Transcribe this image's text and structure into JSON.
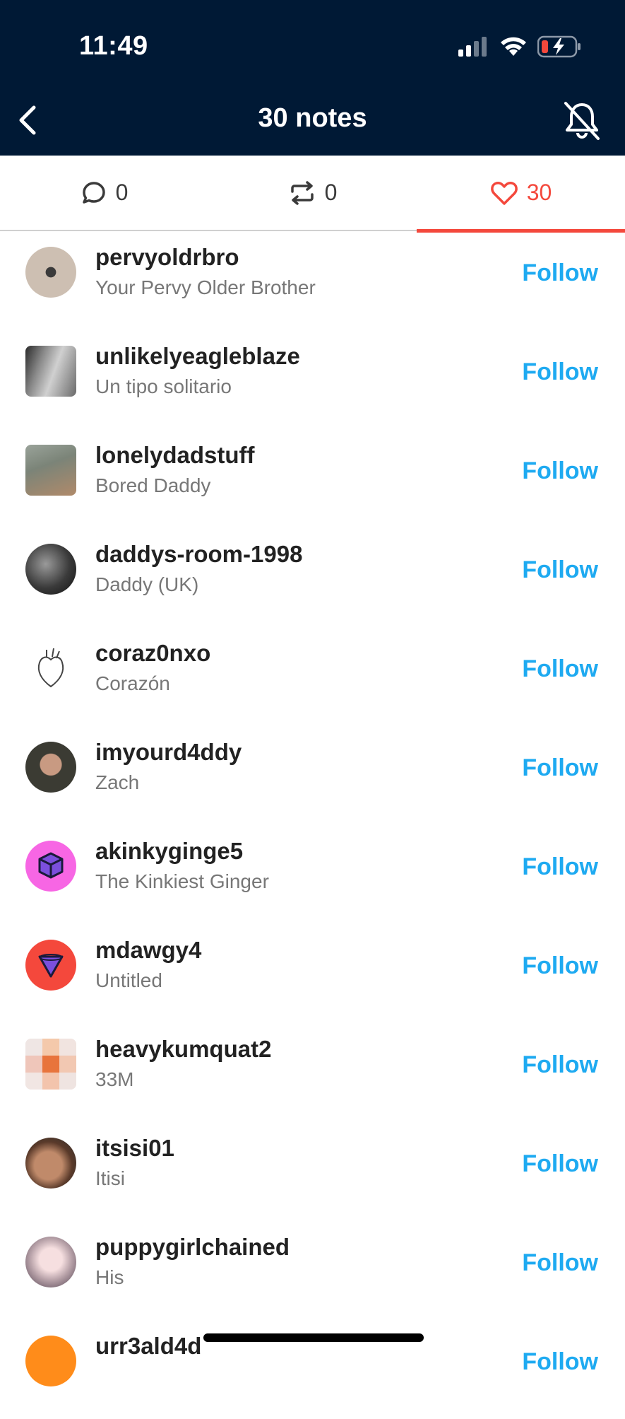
{
  "status": {
    "time": "11:49"
  },
  "header": {
    "title": "30 notes"
  },
  "tabs": [
    {
      "icon": "comment-icon",
      "count": "0"
    },
    {
      "icon": "reblog-icon",
      "count": "0"
    },
    {
      "icon": "heart-icon",
      "count": "30"
    }
  ],
  "colors": {
    "header_bg": "#001935",
    "accent_red": "#f4483c",
    "follow_blue": "#1eaaf1"
  },
  "follow_label": "Follow",
  "users": [
    {
      "username": "pervyoldrbro",
      "title": "Your Pervy Older Brother"
    },
    {
      "username": "unlikelyeagleblaze",
      "title": "Un tipo solitario"
    },
    {
      "username": "lonelydadstuff",
      "title": "Bored Daddy"
    },
    {
      "username": "daddys-room-1998",
      "title": "Daddy (UK)"
    },
    {
      "username": "coraz0nxo",
      "title": "Corazón"
    },
    {
      "username": "imyourd4ddy",
      "title": "Zach"
    },
    {
      "username": "akinkyginge5",
      "title": "The Kinkiest Ginger"
    },
    {
      "username": "mdawgy4",
      "title": "Untitled"
    },
    {
      "username": "heavykumquat2",
      "title": "33M"
    },
    {
      "username": "itsisi01",
      "title": "Itisi"
    },
    {
      "username": "puppygirlchained",
      "title": "His"
    },
    {
      "username": "urr3ald4d",
      "title": ""
    }
  ]
}
